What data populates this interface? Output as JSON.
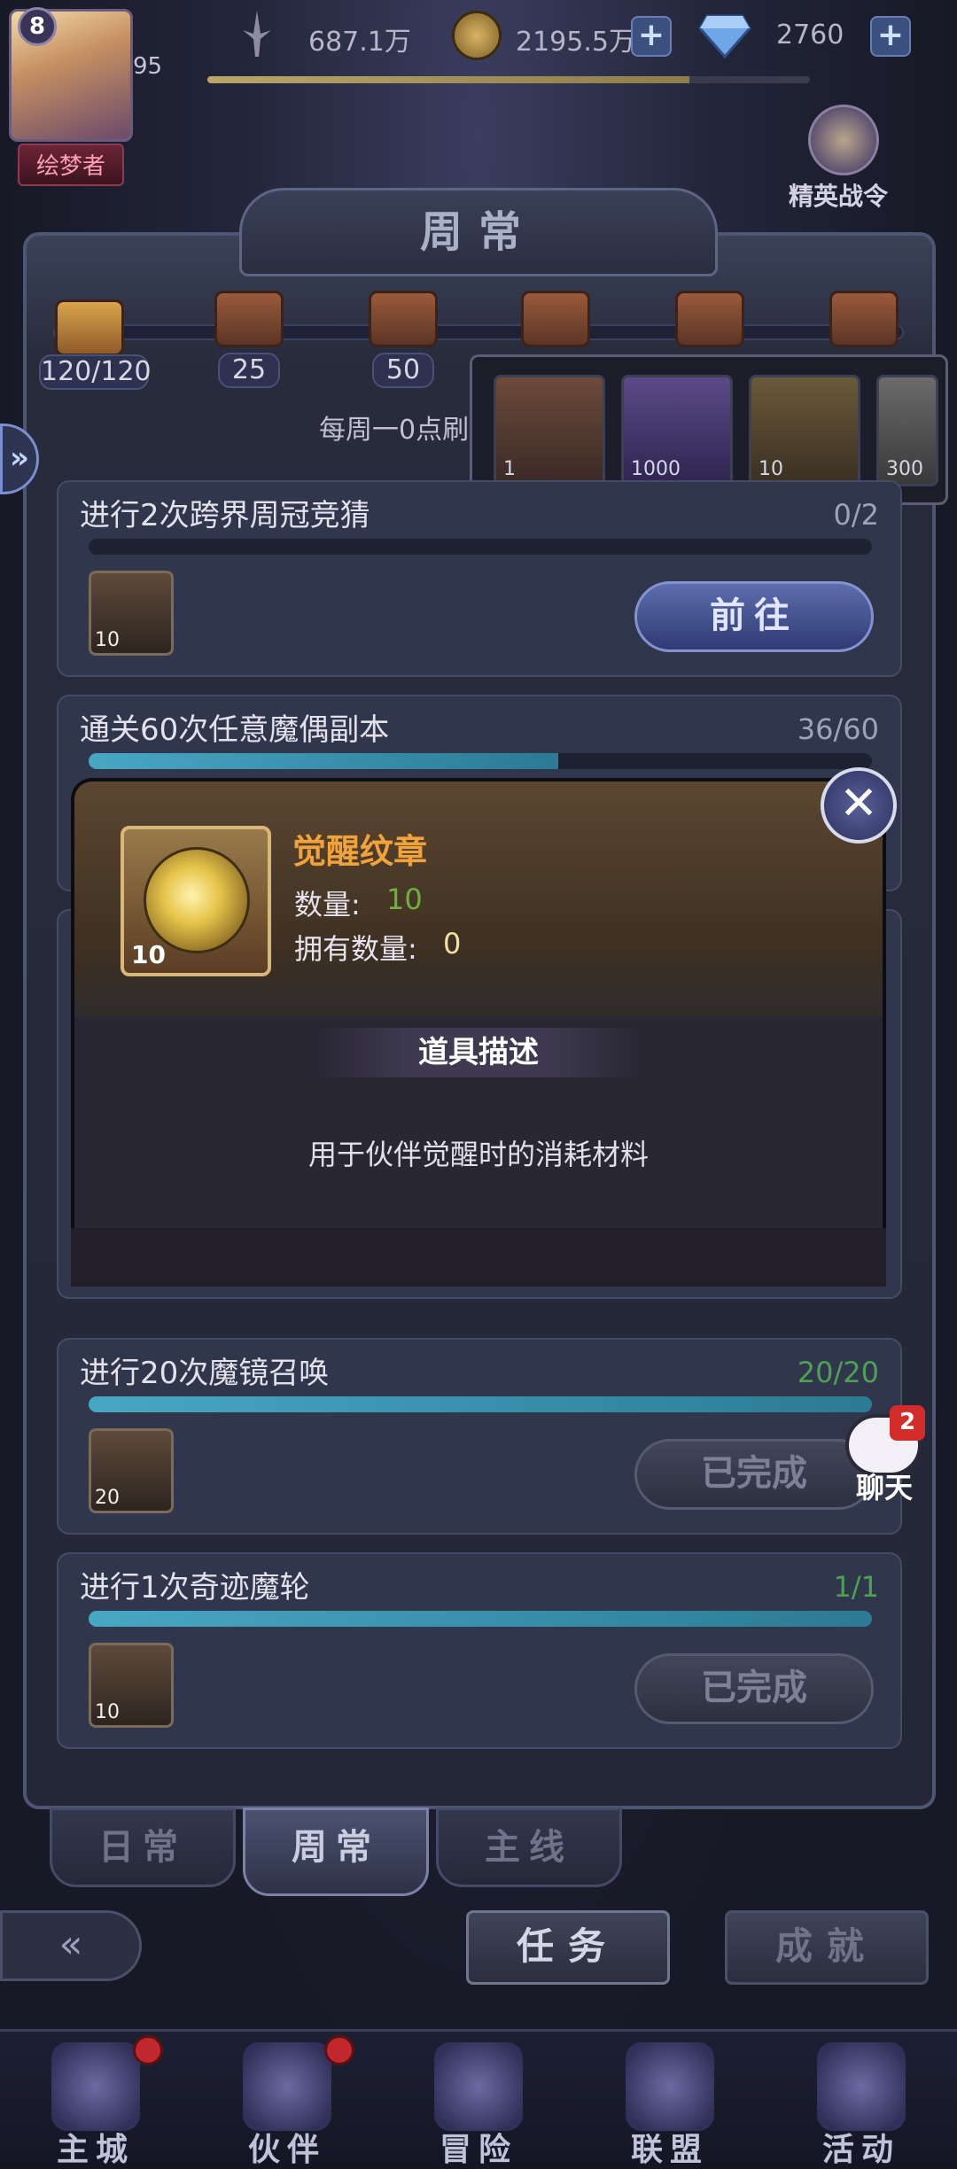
{
  "player": {
    "level": "8",
    "vip_suffix": "95",
    "title": "绘梦者"
  },
  "resources": {
    "power": "687.1万",
    "gold": "2195.5万",
    "diamonds": "2760",
    "xp_fraction": 0.8
  },
  "elite_pass": {
    "label": "精英战令"
  },
  "section_title": "周常",
  "milestones": {
    "first": "120/120",
    "labels": [
      "25",
      "50"
    ],
    "reset_text": "每周一0点刷",
    "fill_fraction": 0.04
  },
  "reward_popup": {
    "items": [
      {
        "count": "1"
      },
      {
        "count": "1000"
      },
      {
        "count": "10"
      },
      {
        "count": "300"
      }
    ]
  },
  "tasks": [
    {
      "title": "进行2次跨界周冠竞猜",
      "progress": "0/2",
      "fraction": 0,
      "icon_count": "10",
      "button": "前往",
      "done": false
    },
    {
      "title": "通关60次任意魔偶副本",
      "progress": "36/60",
      "fraction": 0.6,
      "icon_count": "",
      "button": "",
      "done": false
    },
    {
      "title": "进行20次魔镜召唤",
      "progress": "20/20",
      "fraction": 1,
      "icon_count": "20",
      "button": "已完成",
      "done": true
    },
    {
      "title": "进行1次奇迹魔轮",
      "progress": "1/1",
      "fraction": 1,
      "icon_count": "10",
      "button": "已完成",
      "done": true
    }
  ],
  "item_modal": {
    "name": "觉醒纹章",
    "qty_label": "数量:",
    "qty_value": "10",
    "own_label": "拥有数量:",
    "own_value": "0",
    "icon_count": "10",
    "desc_title": "道具描述",
    "desc_text": "用于伙伴觉醒时的消耗材料",
    "close": "✕"
  },
  "chat": {
    "badge": "2",
    "label": "聊天"
  },
  "sub_tabs": [
    "日常",
    "周常",
    "主线"
  ],
  "actions": {
    "tasks": "任务",
    "achievements": "成就",
    "back": "«"
  },
  "nav": [
    "主城",
    "伙伴",
    "冒险",
    "联盟",
    "活动"
  ],
  "colors": {
    "accent": "#f0a33c",
    "qty_green": "#6ab23a",
    "progress": "#48a7c4"
  }
}
